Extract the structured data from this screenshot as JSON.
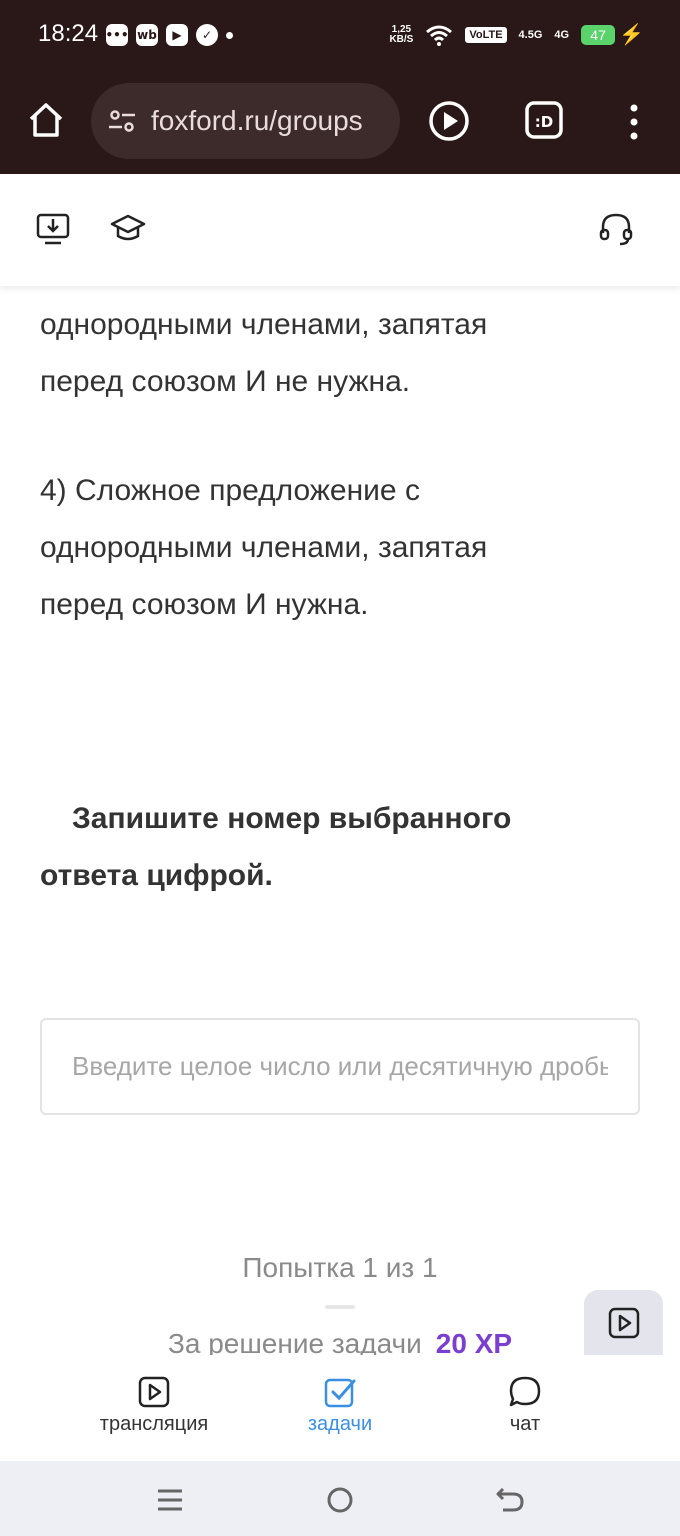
{
  "status_bar": {
    "time": "18:24",
    "left_icons": [
      "chat-bubble-icon",
      "wb-icon",
      "youtube-icon",
      "check-circle-icon"
    ],
    "speed_top": "1,25",
    "speed_bottom": "KB/S",
    "volte": "VoLTE",
    "net1": "4.5G",
    "net2": "4G",
    "battery": "47"
  },
  "browser": {
    "url": "foxford.ru/groups"
  },
  "content": {
    "p1_line1": "однородными членами, запятая",
    "p1_line2": "перед союзом И не нужна.",
    "p2_line1": "4) Сложное предложение с",
    "p2_line2": "однородными членами, запятая",
    "p2_line3": "перед союзом И нужна.",
    "instruction_line1": "Запишите номер выбранного",
    "instruction_line2": "ответа цифрой.",
    "input_placeholder": "Введите целое число или десятичную дробь",
    "input_value": "",
    "attempt": "Попытка 1 из 1",
    "reward_label": "За решение задачи",
    "reward_xp": "20 XP"
  },
  "bottom_nav": {
    "items": [
      {
        "label": "трансляция",
        "icon": "video-play-icon"
      },
      {
        "label": "задачи",
        "icon": "task-check-icon"
      },
      {
        "label": "чат",
        "icon": "chat-icon"
      }
    ],
    "active_index": 1
  },
  "colors": {
    "browser_bg": "#2a1717",
    "accent_active": "#3b8fe0",
    "xp_purple": "#7a3ed1"
  }
}
